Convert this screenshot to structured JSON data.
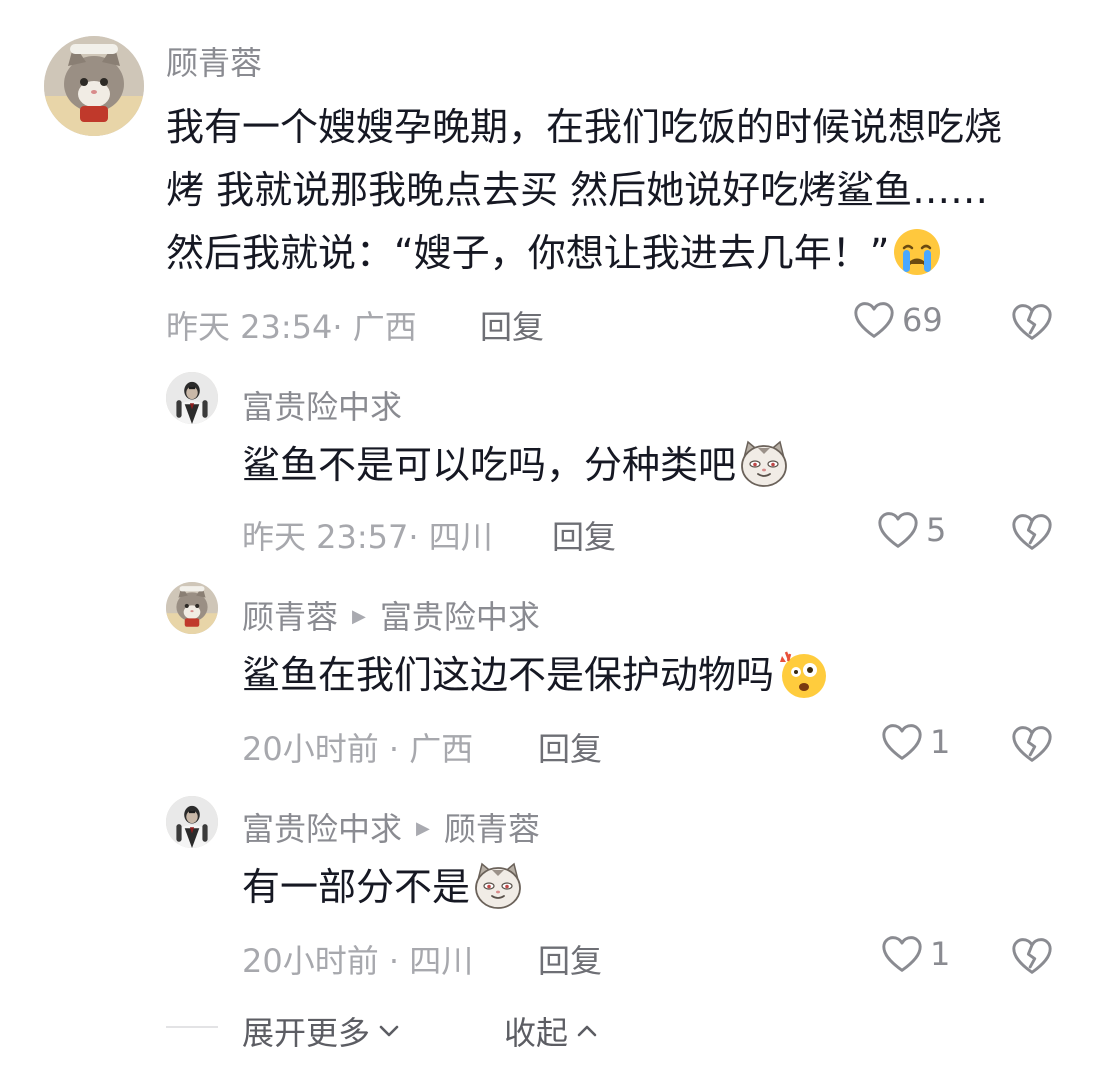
{
  "comments": [
    {
      "author": "顾青蓉",
      "text_lines": [
        "我有一个嫂嫂孕晚期，在我们吃饭的时候说想吃烧",
        "烤 我就说那我晚点去买 然后她说好吃烤鲨鱼……",
        "然后我就说：“嫂子，你想让我进去几年！”"
      ],
      "emoji": "crying-face-emoji",
      "meta": "昨天 23:54· 广西",
      "reply_label": "回复",
      "likes": "69"
    },
    {
      "author": "富贵险中求",
      "text": "鲨鱼不是可以吃吗，分种类吧",
      "emoji": "smirking-cat-emoji",
      "meta": "昨天 23:57· 四川",
      "reply_label": "回复",
      "likes": "5"
    },
    {
      "author": "顾青蓉",
      "reply_to": "富贵险中求",
      "text": "鲨鱼在我们这边不是保护动物吗",
      "emoji": "shocked-face-emoji",
      "meta": "20小时前 · 广西",
      "reply_label": "回复",
      "likes": "1"
    },
    {
      "author": "富贵险中求",
      "reply_to": "顾青蓉",
      "text": "有一部分不是",
      "emoji": "smirking-cat-emoji",
      "meta": "20小时前 · 四川",
      "reply_label": "回复",
      "likes": "1"
    }
  ],
  "footer": {
    "expand_label": "展开更多",
    "collapse_label": "收起"
  },
  "colors": {
    "primary_text": "#161823",
    "secondary_text": "#8a8b91",
    "meta_text": "#a7a8ad"
  }
}
